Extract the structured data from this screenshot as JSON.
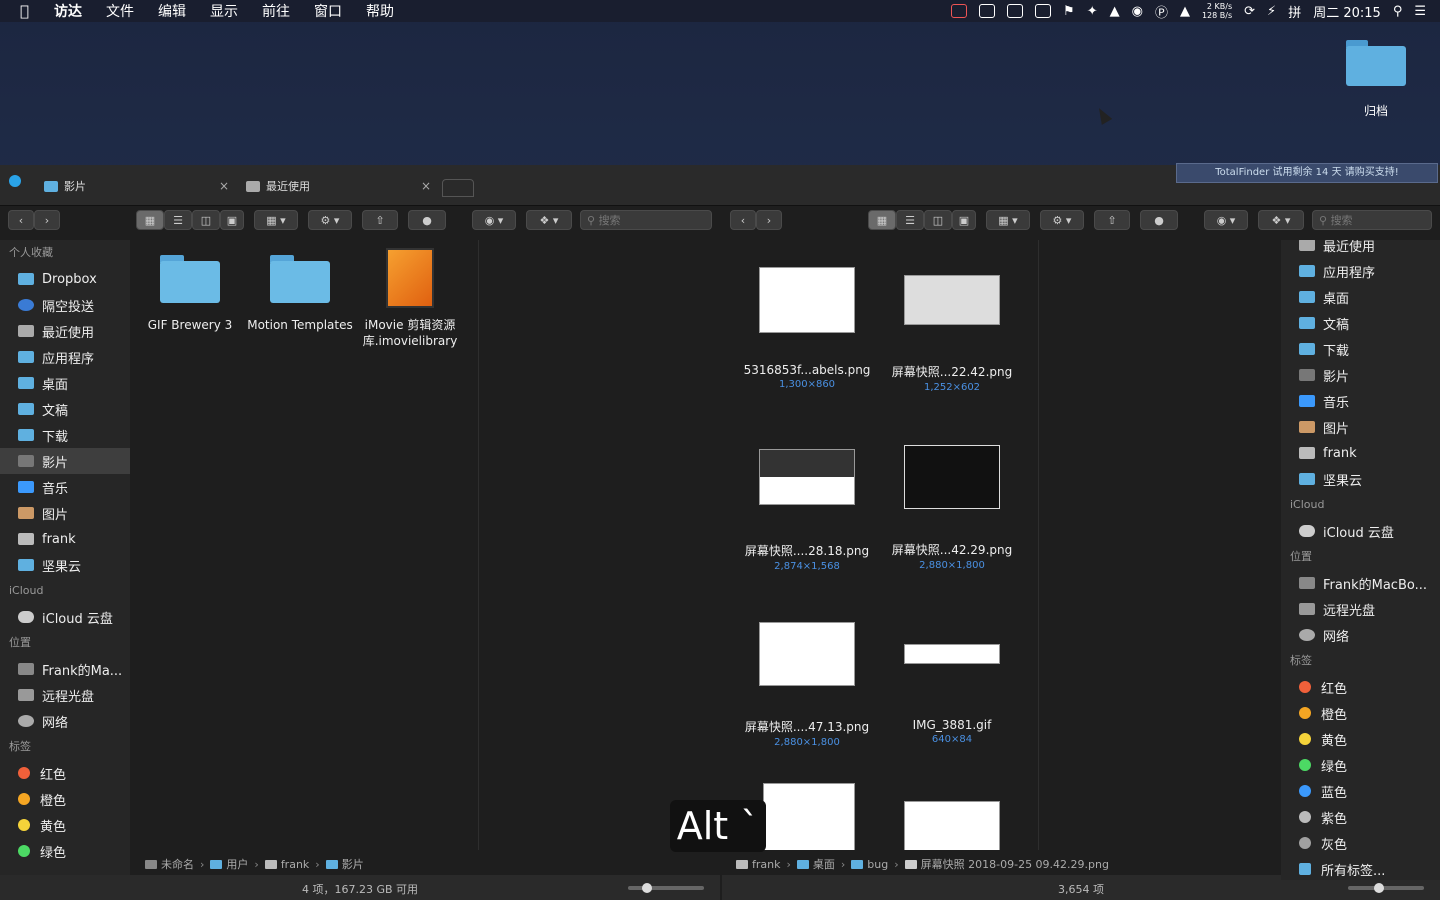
{
  "menubar": {
    "apple": "",
    "items": [
      "访达",
      "文件",
      "编辑",
      "显示",
      "前往",
      "窗口",
      "帮助"
    ],
    "net_up": "2 KB/s",
    "net_down": "128 B/s",
    "ime": "拼",
    "clock": "周二 20:15"
  },
  "desktop": {
    "folder_label": "归档"
  },
  "promo": "TotalFinder 试用剩余 14 天 请购买支持!",
  "tabs": [
    {
      "label": "影片",
      "close": "×"
    },
    {
      "label": "最近使用",
      "close": "×"
    }
  ],
  "toolbar": {
    "search_placeholder": "搜索"
  },
  "sidebar_left": {
    "section_favorites": "个人收藏",
    "favorites": [
      "Dropbox",
      "隔空投送",
      "最近使用",
      "应用程序",
      "桌面",
      "文稿",
      "下载",
      "影片",
      "音乐",
      "图片",
      "frank",
      "坚果云"
    ],
    "section_icloud": "iCloud",
    "icloud": [
      "iCloud 云盘"
    ],
    "section_locations": "位置",
    "locations": [
      "Frank的Ma...",
      "远程光盘",
      "网络"
    ],
    "section_tags": "标签",
    "tags": [
      {
        "label": "红色",
        "color": "#f0603a"
      },
      {
        "label": "橙色",
        "color": "#f5a623"
      },
      {
        "label": "黄色",
        "color": "#f5d33a"
      },
      {
        "label": "绿色",
        "color": "#4cd964"
      }
    ]
  },
  "left_pane": {
    "items": [
      {
        "label": "GIF Brewery 3",
        "kind": "folder"
      },
      {
        "label": "Motion Templates",
        "kind": "folder"
      },
      {
        "label": "iMovie 剪辑资源库.imovielibrary",
        "kind": "imovie"
      }
    ],
    "path": [
      "未命名",
      "用户",
      "frank",
      "影片"
    ],
    "status": "4 项，167.23 GB 可用"
  },
  "right_pane": {
    "files": [
      {
        "name": "5316853f...abels.png",
        "dim": "1,300×860"
      },
      {
        "name": "屏幕快照...22.42.png",
        "dim": "1,252×602"
      },
      {
        "name": "屏幕快照....28.18.png",
        "dim": "2,874×1,568"
      },
      {
        "name": "屏幕快照...42.29.png",
        "dim": "2,880×1,800"
      },
      {
        "name": "屏幕快照....47.13.png",
        "dim": "2,880×1,800"
      },
      {
        "name": "IMG_3881.gif",
        "dim": "640×84"
      }
    ],
    "path": [
      "frank",
      "桌面",
      "bug",
      "屏幕快照 2018-09-25 09.42.29.png"
    ],
    "status": "3,654 项"
  },
  "sidebar_right": {
    "favorites": [
      "最近使用",
      "应用程序",
      "桌面",
      "文稿",
      "下载",
      "影片",
      "音乐",
      "图片",
      "frank",
      "坚果云"
    ],
    "section_icloud": "iCloud",
    "icloud": [
      "iCloud 云盘"
    ],
    "section_locations": "位置",
    "locations": [
      "Frank的MacBo...",
      "远程光盘",
      "网络"
    ],
    "section_tags": "标签",
    "tags": [
      {
        "label": "红色",
        "color": "#f0603a"
      },
      {
        "label": "橙色",
        "color": "#f5a623"
      },
      {
        "label": "黄色",
        "color": "#f5d33a"
      },
      {
        "label": "绿色",
        "color": "#4cd964"
      },
      {
        "label": "蓝色",
        "color": "#3b99fc"
      },
      {
        "label": "紫色",
        "color": "#bbbbbb"
      },
      {
        "label": "灰色",
        "color": "#a0a0a0"
      },
      {
        "label": "所有标签...",
        "color": ""
      }
    ]
  },
  "overlay": {
    "keys": "Alt `"
  }
}
